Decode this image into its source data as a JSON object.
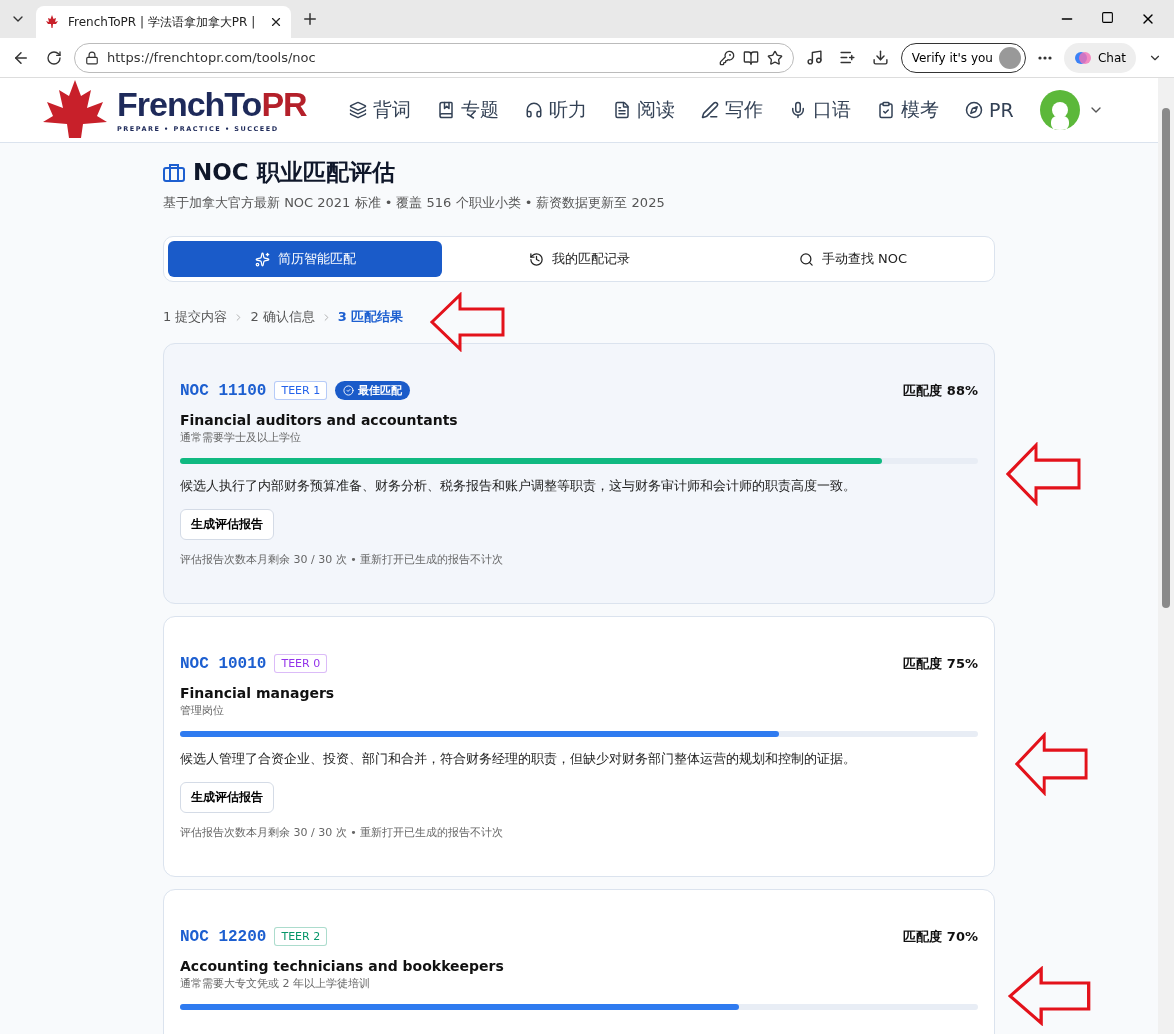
{
  "browser": {
    "tab_title": "FrenchToPR | 学法语拿加拿大PR |",
    "url": "https://frenchtopr.com/tools/noc",
    "verify_label": "Verify it's you",
    "chat_label": "Chat"
  },
  "header": {
    "brand_main": "FrenchTo",
    "brand_accent": "PR",
    "tagline": "PREPARE • PRACTICE • SUCCEED",
    "nav": [
      {
        "label": "背词"
      },
      {
        "label": "专题"
      },
      {
        "label": "听力"
      },
      {
        "label": "阅读"
      },
      {
        "label": "写作"
      },
      {
        "label": "口语"
      },
      {
        "label": "模考"
      },
      {
        "label": "PR"
      }
    ]
  },
  "page": {
    "title": "NOC 职业匹配评估",
    "subtitle": "基于加拿大官方最新 NOC 2021 标准 • 覆盖 516 个职业小类 • 薪资数据更新至 2025",
    "tabs": [
      {
        "label": "简历智能匹配",
        "selected": true
      },
      {
        "label": "我的匹配记录",
        "selected": false
      },
      {
        "label": "手动查找 NOC",
        "selected": false
      }
    ],
    "steps": [
      {
        "label": "1 提交内容",
        "selected": false
      },
      {
        "label": "2 确认信息",
        "selected": false
      },
      {
        "label": "3 匹配结果",
        "selected": true
      }
    ],
    "results": [
      {
        "code": "NOC 11100",
        "tier": {
          "label": "TEER 1",
          "color": "#2563eb"
        },
        "best": true,
        "best_label": "最佳匹配",
        "match": "匹配度 88%",
        "title": "Financial auditors and accountants",
        "education": "通常需要学士及以上学位",
        "level": 0.88,
        "reason": "候选人执行了内部财务预算准备、财务分析、税务报告和账户调整等职责，这与财务审计师和会计师的职责高度一致。",
        "button": "生成评估报告",
        "quota": "评估报告次数本月剩余 30 / 30 次 • 重新打开已生成的报告不计次"
      },
      {
        "code": "NOC 10010",
        "tier": {
          "label": "TEER 0",
          "color": "#9333ea"
        },
        "best": false,
        "match": "匹配度 75%",
        "title": "Financial managers",
        "education": "管理岗位",
        "level": 0.75,
        "reason": "候选人管理了合资企业、投资、部门和合并，符合财务经理的职责，但缺少对财务部门整体运营的规划和控制的证据。",
        "button": "生成评估报告",
        "quota": "评估报告次数本月剩余 30 / 30 次 • 重新打开已生成的报告不计次"
      },
      {
        "code": "NOC 12200",
        "tier": {
          "label": "TEER 2",
          "color": "#059669"
        },
        "best": false,
        "match": "匹配度 70%",
        "title": "Accounting technicians and bookkeepers",
        "education": "通常需要大专文凭或 2 年以上学徒培训",
        "level": 0.7
      }
    ]
  }
}
